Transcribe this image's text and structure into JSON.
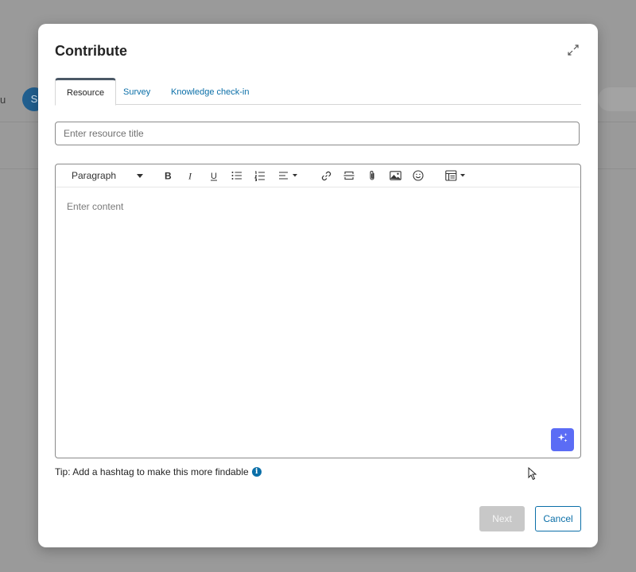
{
  "background": {
    "left_text": "u",
    "pill_text": "S"
  },
  "modal": {
    "title": "Contribute",
    "expand_icon": "expand-arrows-icon"
  },
  "tabs": [
    {
      "label": "Resource",
      "active": true
    },
    {
      "label": "Survey",
      "active": false
    },
    {
      "label": "Knowledge check-in",
      "active": false
    }
  ],
  "title_input": {
    "placeholder": "Enter resource title",
    "value": ""
  },
  "editor": {
    "paragraph_select": "Paragraph",
    "toolbar_icons": [
      "bold-icon",
      "italic-icon",
      "underline-icon",
      "bulleted-list-icon",
      "numbered-list-icon",
      "align-icon",
      "link-icon",
      "divider-icon",
      "attachment-icon",
      "image-icon",
      "emoji-icon",
      "table-icon"
    ],
    "placeholder": "Enter content",
    "ai_button_icon": "sparkle-icon"
  },
  "tip": {
    "text": "Tip: Add a hashtag to make this more findable",
    "icon": "info-icon"
  },
  "buttons": {
    "next": "Next",
    "cancel": "Cancel"
  },
  "colors": {
    "accent": "#0b6fa8",
    "ai_button": "#5b6cf5",
    "tab_indicator": "#4b5866",
    "disabled_button": "#c8c8c8"
  }
}
